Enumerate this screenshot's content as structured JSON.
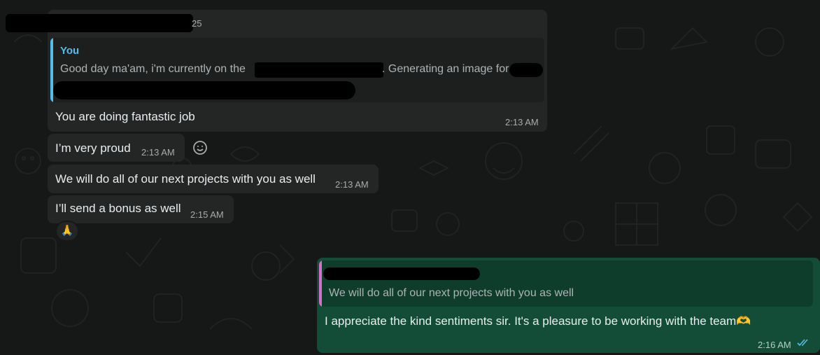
{
  "incoming": {
    "header_suffix": "25",
    "quote": {
      "author": "You",
      "text_start": "Good day ma'am, i'm currently on the",
      "text_mid": ". Generating an image for"
    },
    "messages": [
      {
        "text": "You are doing fantastic job",
        "time": "2:13 AM"
      },
      {
        "text": "I’m very proud",
        "time": "2:13 AM"
      },
      {
        "text": "We will do all of our next projects with you as well",
        "time": "2:13 AM"
      },
      {
        "text": "I’ll send a bonus as well",
        "time": "2:15 AM",
        "reaction": "🙏"
      }
    ]
  },
  "outgoing": {
    "quote_text": "We will do all of our next projects with you as well",
    "text": "I appreciate the kind sentiments sir. It's a pleasure to be working with the team",
    "emoji": "🫶",
    "time": "2:16 AM",
    "status_icon": "double-check-read-icon"
  },
  "colors": {
    "background": "#161717",
    "incoming_bubble": "#242626",
    "outgoing_bubble": "#144d37",
    "quote_you_accent": "#53bdeb",
    "quote_reply_accent": "#d66fc9",
    "read_ticks": "#53bdeb"
  }
}
